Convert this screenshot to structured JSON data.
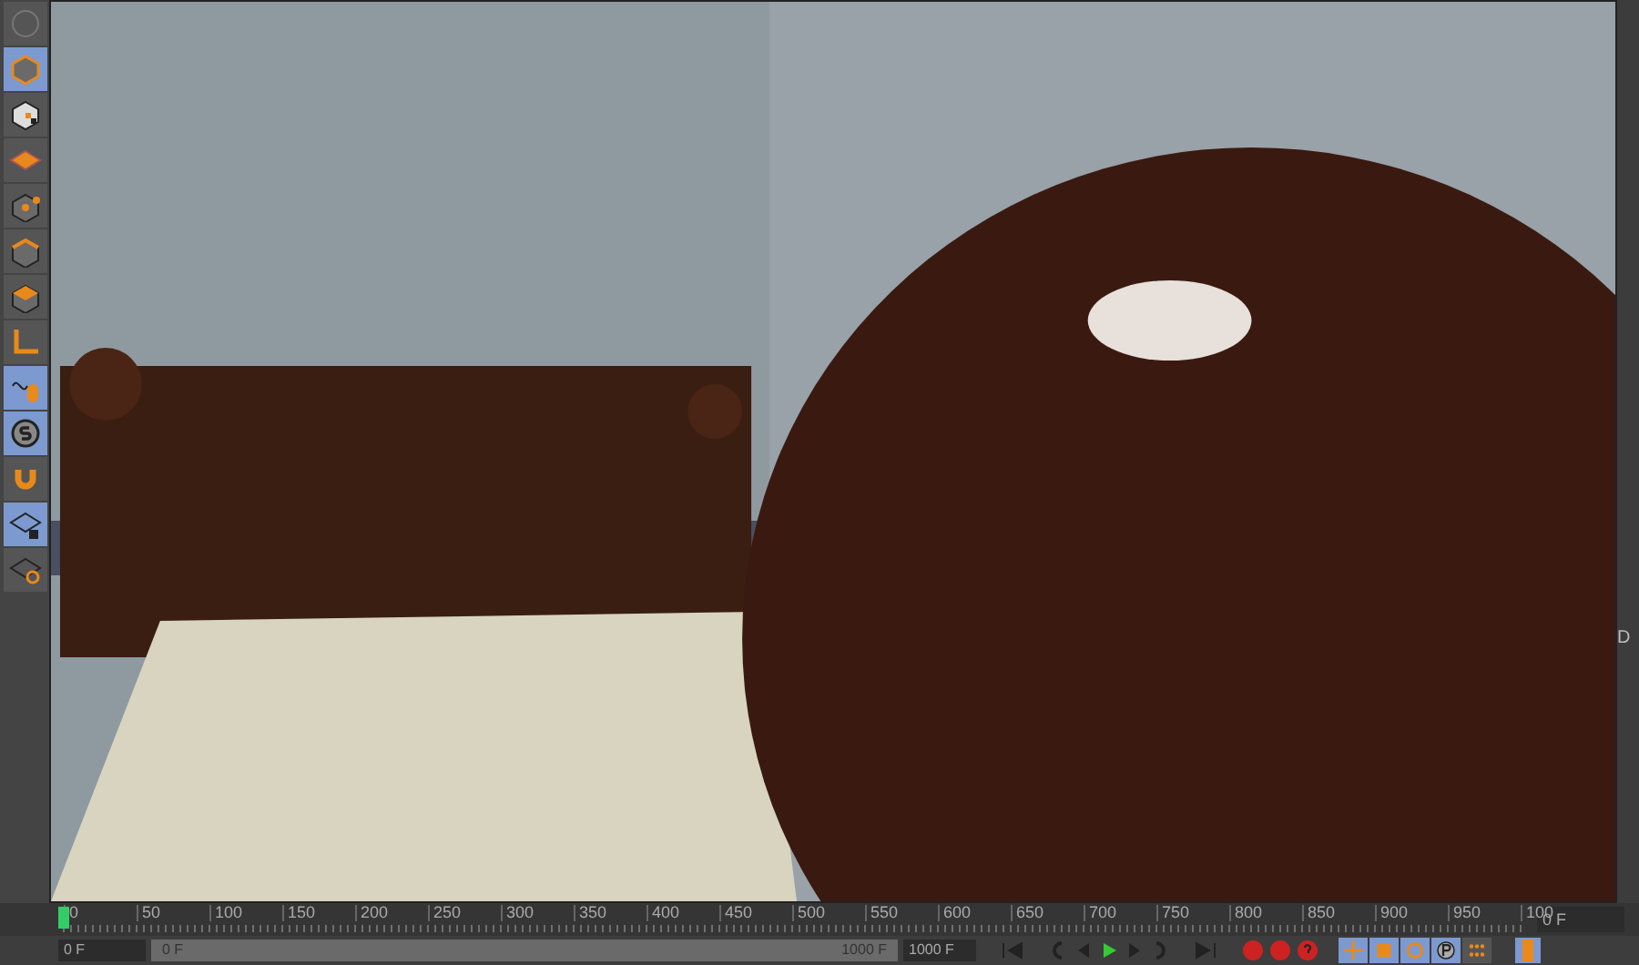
{
  "toolbar": [
    {
      "kind": "faded",
      "selected": false
    },
    {
      "kind": "cube",
      "selected": true
    },
    {
      "kind": "cube-checker",
      "selected": false
    },
    {
      "kind": "plane",
      "selected": false
    },
    {
      "kind": "points",
      "selected": false
    },
    {
      "kind": "edges",
      "selected": false
    },
    {
      "kind": "polygons",
      "selected": false
    },
    {
      "kind": "axis",
      "selected": false
    },
    {
      "kind": "mouse",
      "selected": true
    },
    {
      "kind": "s",
      "selected": true
    },
    {
      "kind": "magnet",
      "selected": false
    },
    {
      "kind": "grid-lock",
      "selected": true
    },
    {
      "kind": "grid-loop",
      "selected": false
    }
  ],
  "timeline": {
    "ticks": [
      "0",
      "50",
      "100",
      "150",
      "200",
      "250",
      "300",
      "350",
      "400",
      "450",
      "500",
      "550",
      "600",
      "650",
      "700",
      "750",
      "800",
      "850",
      "900",
      "950",
      "100"
    ],
    "level": 0,
    "current_frame": "0 F"
  },
  "range": {
    "start_field": "0 F",
    "slider_start": "0 F",
    "slider_end": "1000 F",
    "end_field": "1000 F",
    "level": 1
  },
  "side_panel": {
    "label": "D"
  },
  "key_tools": [
    {
      "kind": "move",
      "selected": true
    },
    {
      "kind": "scale",
      "selected": true
    },
    {
      "kind": "rotate",
      "selected": true
    },
    {
      "kind": "param",
      "selected": true
    },
    {
      "kind": "dots",
      "selected": false
    }
  ]
}
